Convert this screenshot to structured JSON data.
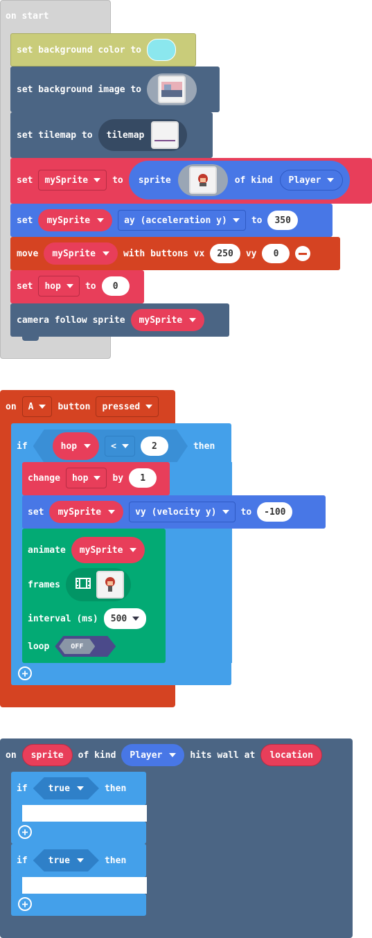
{
  "colors": {
    "event_grey": "#d4d4d4",
    "scene": "#4b6584",
    "sprites": "#e83e5a",
    "sprite_block": "#4877e6",
    "controller": "#d54322",
    "logic": "#44a0ea",
    "animation": "#03aa74",
    "bg_swatch": "#8be7ee"
  },
  "on_start": {
    "label": "on start",
    "bg_color": {
      "text": "set background color to"
    },
    "bg_image": {
      "text": "set background image to"
    },
    "tilemap": {
      "text": "set tilemap to",
      "value": "tilemap"
    },
    "set_sprite": {
      "set": "set",
      "var": "mySprite",
      "to": "to",
      "sprite": "sprite",
      "of_kind": "of kind",
      "kind": "Player"
    },
    "set_ay": {
      "set": "set",
      "var": "mySprite",
      "prop": "ay (acceleration y)",
      "to": "to",
      "value": "350"
    },
    "move": {
      "move": "move",
      "var": "mySprite",
      "with": "with buttons vx",
      "vx": "250",
      "vy_label": "vy",
      "vy": "0"
    },
    "set_hop": {
      "set": "set",
      "var": "hop",
      "to": "to",
      "value": "0"
    },
    "camera": {
      "text": "camera follow sprite",
      "var": "mySprite"
    }
  },
  "on_a": {
    "on": "on",
    "button": "A",
    "button_label": "button",
    "event": "pressed",
    "if": "if",
    "cond_var": "hop",
    "op": "<",
    "cond_val": "2",
    "then": "then",
    "change": {
      "label": "change",
      "var": "hop",
      "by": "by",
      "value": "1"
    },
    "set_vy": {
      "set": "set",
      "var": "mySprite",
      "prop": "vy (velocity y)",
      "to": "to",
      "value": "-100"
    },
    "animate": {
      "label": "animate",
      "var": "mySprite",
      "frames": "frames",
      "interval": "interval (ms)",
      "interval_value": "500",
      "loop": "loop",
      "loop_state": "OFF"
    }
  },
  "on_hit": {
    "on": "on",
    "sprite": "sprite",
    "of_kind": "of kind",
    "kind": "Player",
    "hits": "hits wall at",
    "location": "location",
    "if1": {
      "if": "if",
      "cond": "true",
      "then": "then"
    },
    "if2": {
      "if": "if",
      "cond": "true",
      "then": "then"
    }
  }
}
